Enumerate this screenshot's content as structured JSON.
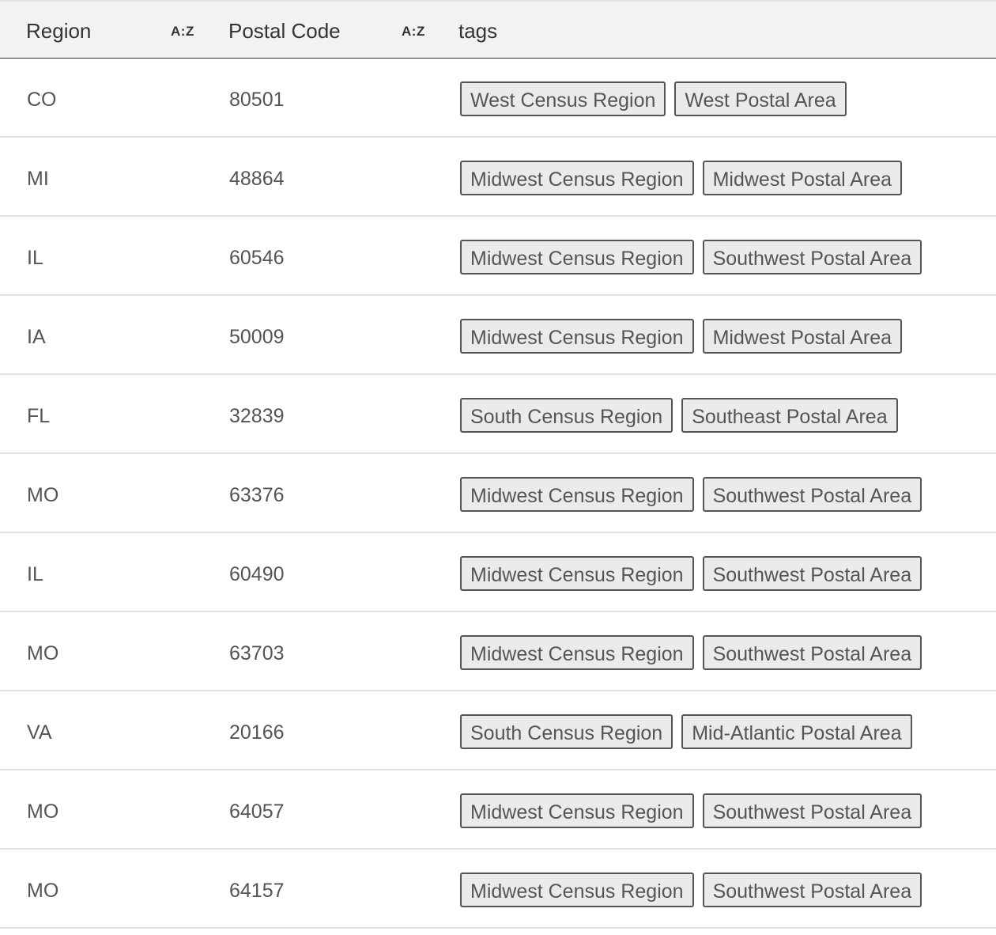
{
  "header": {
    "columns": [
      {
        "label": "Region",
        "sort_label": "A:Z"
      },
      {
        "label": "Postal Code",
        "sort_label": "A:Z"
      },
      {
        "label": "tags"
      }
    ]
  },
  "rows": [
    {
      "region": "CO",
      "postal_code": "80501",
      "tags": [
        "West Census Region",
        "West Postal Area"
      ]
    },
    {
      "region": "MI",
      "postal_code": "48864",
      "tags": [
        "Midwest Census Region",
        "Midwest Postal Area"
      ]
    },
    {
      "region": "IL",
      "postal_code": "60546",
      "tags": [
        "Midwest Census Region",
        "Southwest Postal Area"
      ]
    },
    {
      "region": "IA",
      "postal_code": "50009",
      "tags": [
        "Midwest Census Region",
        "Midwest Postal Area"
      ]
    },
    {
      "region": "FL",
      "postal_code": "32839",
      "tags": [
        "South Census Region",
        "Southeast Postal Area"
      ]
    },
    {
      "region": "MO",
      "postal_code": "63376",
      "tags": [
        "Midwest Census Region",
        "Southwest Postal Area"
      ]
    },
    {
      "region": "IL",
      "postal_code": "60490",
      "tags": [
        "Midwest Census Region",
        "Southwest Postal Area"
      ]
    },
    {
      "region": "MO",
      "postal_code": "63703",
      "tags": [
        "Midwest Census Region",
        "Southwest Postal Area"
      ]
    },
    {
      "region": "VA",
      "postal_code": "20166",
      "tags": [
        "South Census Region",
        "Mid-Atlantic Postal Area"
      ]
    },
    {
      "region": "MO",
      "postal_code": "64057",
      "tags": [
        "Midwest Census Region",
        "Southwest Postal Area"
      ]
    },
    {
      "region": "MO",
      "postal_code": "64157",
      "tags": [
        "Midwest Census Region",
        "Southwest Postal Area"
      ]
    }
  ]
}
